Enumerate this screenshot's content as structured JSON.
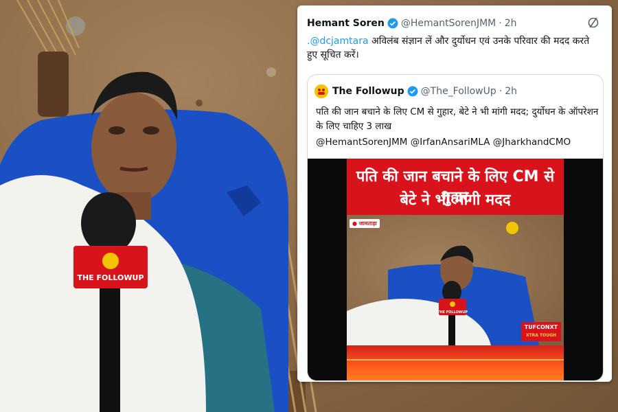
{
  "tweet": {
    "author": "Hemant Soren",
    "handle": "@HemantSorenJMM",
    "separator": "·",
    "time": "2h",
    "mention": ".@dcjamtara",
    "text": " अविलंब संज्ञान लें और दुर्योधन एवं उनके परिवार की मदद करते हुए सूचित करें।"
  },
  "quote": {
    "author": "The Followup",
    "handle": "@The_FollowUp",
    "separator": "·",
    "time": "2h",
    "text": "पति की जान बचाने के लिए CM से गुहार, बेटे ने भी मांगी मदद; दुर्योधन के ऑपरेशन के लिए चाहिए 3 लाख",
    "mentions": "@HemantSorenJMM @IrfanAnsariMLA @JharkhandCMO"
  },
  "media": {
    "headline_line1": "पति की जान बचाने के लिए CM से गुहार",
    "headline_line2": "बेटे ने भी मांगी मदद",
    "location": "जामताड़ा",
    "mic_label": "THE FOLLOWUP",
    "sponsor_label": "TUFCONXT",
    "sponsor_tagline": "XTRA TOUGH"
  },
  "photo": {
    "mic_label": "THE FOLLOWUP"
  },
  "colors": {
    "brand_red": "#d8131b",
    "brand_yellow": "#f5c400",
    "link_blue": "#1d9bf0",
    "verified_blue": "#1d9bf0",
    "tarp_blue": "#1b4fc4"
  }
}
